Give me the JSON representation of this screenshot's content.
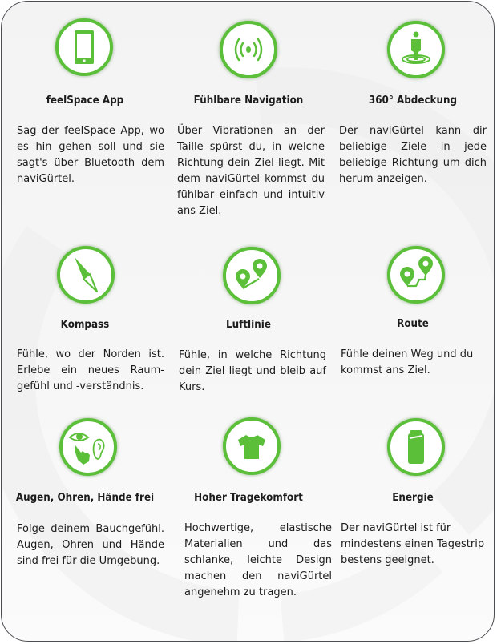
{
  "accent_color": "#5cbf3a",
  "features": [
    {
      "icon": "smartphone-icon",
      "title": "feelSpace App",
      "text": "Sag der feelSpace App, wo es hin gehen soll und sie sagt's über Bluetooth dem naviGürtel."
    },
    {
      "icon": "vibration-icon",
      "title": "Fühlbare Navigation",
      "text": "Über Vibrationen an der Taille spürst du, in welche Richtung dein Ziel liegt. Mit dem naviGürtel kommst du fühlbar einfach und intuitiv ans Ziel."
    },
    {
      "icon": "person-radius-icon",
      "title": "360° Abdeckung",
      "text": "Der naviGürtel kann dir beliebige Ziele in jede beliebige Richtung um dich herum anzeigen."
    },
    {
      "icon": "compass-icon",
      "title": "Kompass",
      "text": "Fühle, wo der Norden ist. Erlebe ein neues Raum-gefühl und -verständnis."
    },
    {
      "icon": "straight-line-pins-icon",
      "title": "Luftlinie",
      "text": "Fühle, in welche Richtung dein Ziel liegt und bleib auf Kurs."
    },
    {
      "icon": "route-pins-icon",
      "title": "Route",
      "text": "Fühle deinen Weg und du kommst ans Ziel."
    },
    {
      "icon": "eye-ear-hand-icon",
      "title": "Augen, Ohren, Hände frei",
      "text": "Folge deinem Bauchgefühl. Augen, Ohren und Hände sind frei für die Umgebung."
    },
    {
      "icon": "tshirt-icon",
      "title": "Hoher Tragekomfort",
      "text": "Hochwertige, elastische Materialien und das schlanke, leichte Design machen den naviGürtel angenehm zu tragen."
    },
    {
      "icon": "battery-icon",
      "title": "Energie",
      "text": "Der naviGürtel ist für mindestens einen Tagestrip bestens geeignet."
    }
  ]
}
